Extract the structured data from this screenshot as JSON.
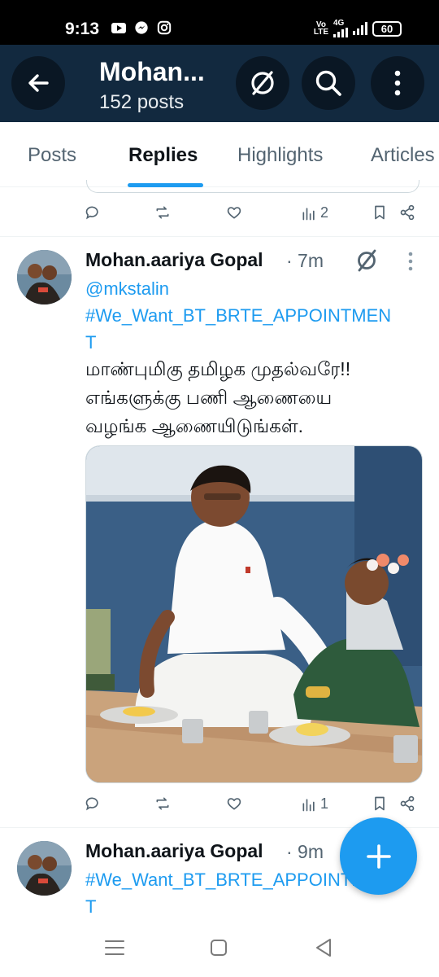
{
  "status_bar": {
    "time": "9:13",
    "volte_top": "Vo",
    "volte_bottom": "LTE",
    "network": "4G",
    "battery": "60"
  },
  "app_bar": {
    "title": "Mohan...",
    "subtitle": "152 posts",
    "icons": [
      "back-arrow-icon",
      "no-signal-icon",
      "search-icon",
      "more-vert-icon"
    ]
  },
  "tabs": [
    {
      "label": "Posts"
    },
    {
      "label": "Replies"
    },
    {
      "label": "Highlights"
    },
    {
      "label": "Articles"
    }
  ],
  "active_tab": "Replies",
  "prev_post": {
    "views": "2"
  },
  "post1": {
    "author": "Mohan.aariya Gopal",
    "time": "· 7m",
    "mention": "@mkstalin",
    "hashtag_line1": "#We_Want_BT_BRTE_APPOINTMEN",
    "hashtag_line2": "T",
    "tamil_line1": "மாண்புமிகு தமிழக முதல்வரே!!",
    "tamil_line2": " எங்களுக்கு பணி ஆணையை",
    "tamil_line3": "வழங்க ஆணையிடுங்கள்.",
    "views": "1"
  },
  "post2": {
    "author": "Mohan.aariya Gopal",
    "time": "· 9m",
    "hashtag_line1": "#We_Want_BT_BRTE_APPOINTMEN",
    "hashtag_line2": "T"
  },
  "colors": {
    "accent": "#1d9bf0",
    "header_bg": "#12293f",
    "muted_text": "#536471"
  }
}
